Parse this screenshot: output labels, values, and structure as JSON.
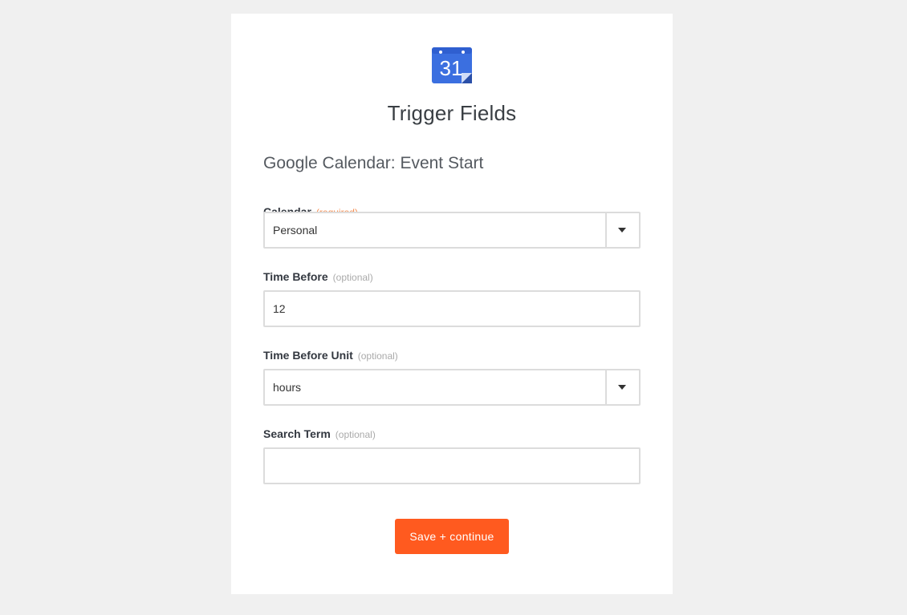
{
  "app": {
    "icon": "google-calendar-icon",
    "icon_number": "31",
    "icon_color": "#3b6fe0"
  },
  "page": {
    "title": "Trigger Fields",
    "subtitle": "Google Calendar: Event Start"
  },
  "fields": [
    {
      "label": "Calendar",
      "hint": "(required)",
      "type": "select",
      "value": "Personal"
    },
    {
      "label": "Time Before",
      "hint": "(optional)",
      "type": "text",
      "value": "12"
    },
    {
      "label": "Time Before Unit",
      "hint": "(optional)",
      "type": "select",
      "value": "hours"
    },
    {
      "label": "Search Term",
      "hint": "(optional)",
      "type": "text",
      "value": ""
    }
  ],
  "actions": {
    "save_label": "Save + continue"
  },
  "colors": {
    "accent": "#ff5a1f",
    "required_hint": "#f48a4d",
    "background": "#f0f0f0"
  }
}
